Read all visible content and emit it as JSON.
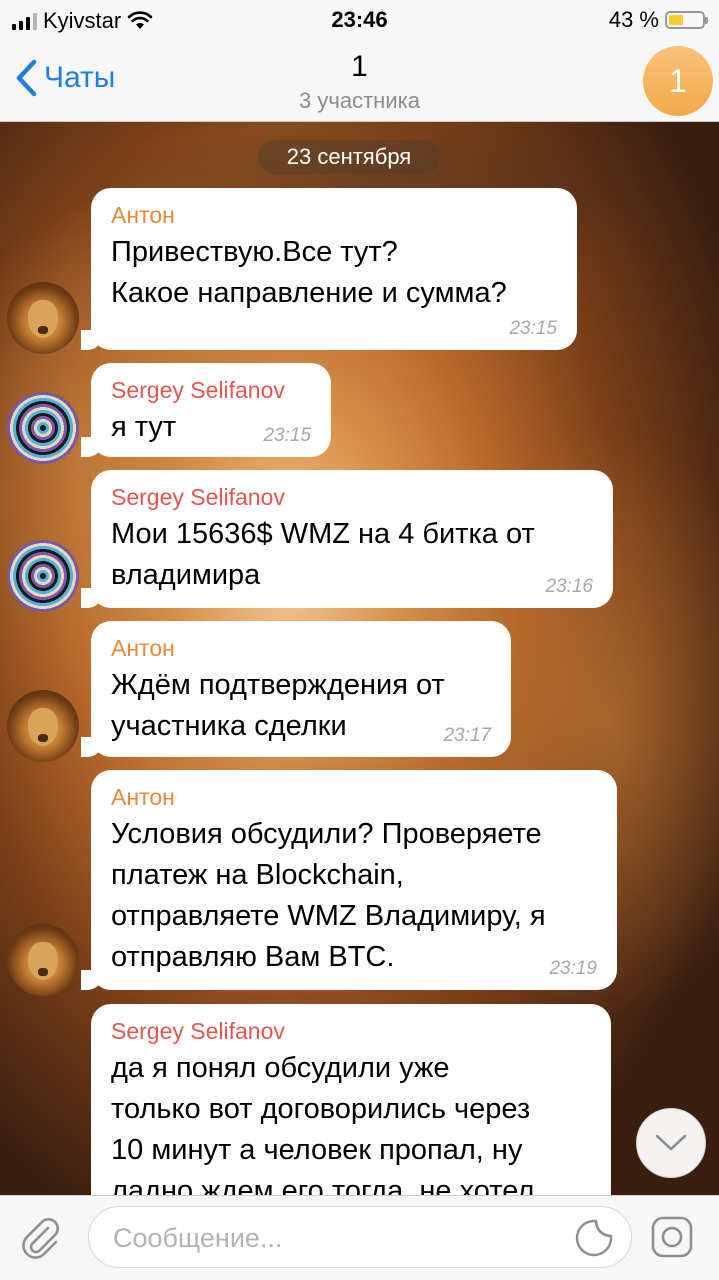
{
  "status_bar": {
    "carrier": "Kyivstar",
    "time": "23:46",
    "battery_percent": "43 %",
    "battery_level": 0.43
  },
  "header": {
    "back_label": "Чаты",
    "title": "1",
    "subtitle": "3 участника",
    "avatar_letter": "1"
  },
  "chat": {
    "date_label": "23 сентября",
    "messages": [
      {
        "sender": "Антон",
        "text": "Привествую.Все тут?\nКакое направление и сумма?",
        "time": "23:15",
        "avatar": "lion-icon"
      },
      {
        "sender": "Sergey Selifanov",
        "text": "я тут",
        "time": "23:15",
        "avatar": "hypno-icon"
      },
      {
        "sender": "Sergey Selifanov",
        "text": "Мои 15636$ WMZ на 4 битка от\nвладимира",
        "time": "23:16",
        "avatar": "hypno-icon"
      },
      {
        "sender": "Антон",
        "text": "Ждём подтверждения от\nучастника сделки",
        "time": "23:17",
        "avatar": "lion-icon"
      },
      {
        "sender": "Антон",
        "text": "Условия обсудили? Проверяете\nплатеж на Blockchain,\nотправляете WMZ Владимиру, я\nотправляю Вам BTC.",
        "time": "23:19",
        "avatar": "lion-icon"
      },
      {
        "sender": "Sergey Selifanov",
        "text": "да я понял обсудили уже\nтолько вот договорились через\n10 минут а человек пропал, ну\nладно ждем его тогда, не хотел",
        "time": "",
        "avatar": "hypno-icon"
      }
    ]
  },
  "input": {
    "placeholder": "Сообщение..."
  },
  "colors": {
    "accent": "#1f7fe0",
    "sender_anton": "#e98a3a",
    "sender_sergey": "#e2584f"
  }
}
